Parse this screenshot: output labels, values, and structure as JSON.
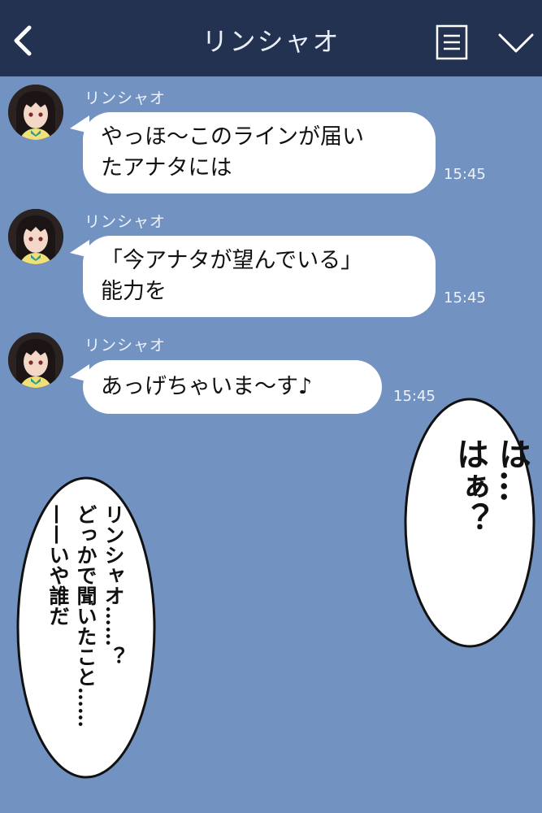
{
  "header": {
    "title": "リンシャオ",
    "back_icon": "chevron-left-icon",
    "menu_icon": "list-icon",
    "expand_icon": "chevron-down-icon",
    "background": "#233250"
  },
  "chat": {
    "background": "#7292c1",
    "messages": [
      {
        "sender": "リンシャオ",
        "line1": "やっほ〜このラインが届い",
        "line2": "たアナタには",
        "time": "15:45"
      },
      {
        "sender": "リンシャオ",
        "line1": "「今アナタが望んでいる」",
        "line2": "能力を",
        "time": "15:45"
      },
      {
        "sender": "リンシャオ",
        "line1": "あっげちゃいま〜す♪",
        "time": "15:45"
      }
    ]
  },
  "overlays": {
    "right_bubble": {
      "line1": "は…",
      "line2": "はぁ？"
    },
    "left_bubble": {
      "line1": "リンシャオ……？",
      "line2": "どっかで聞いたこと……",
      "line3": "——いや誰だ"
    }
  }
}
